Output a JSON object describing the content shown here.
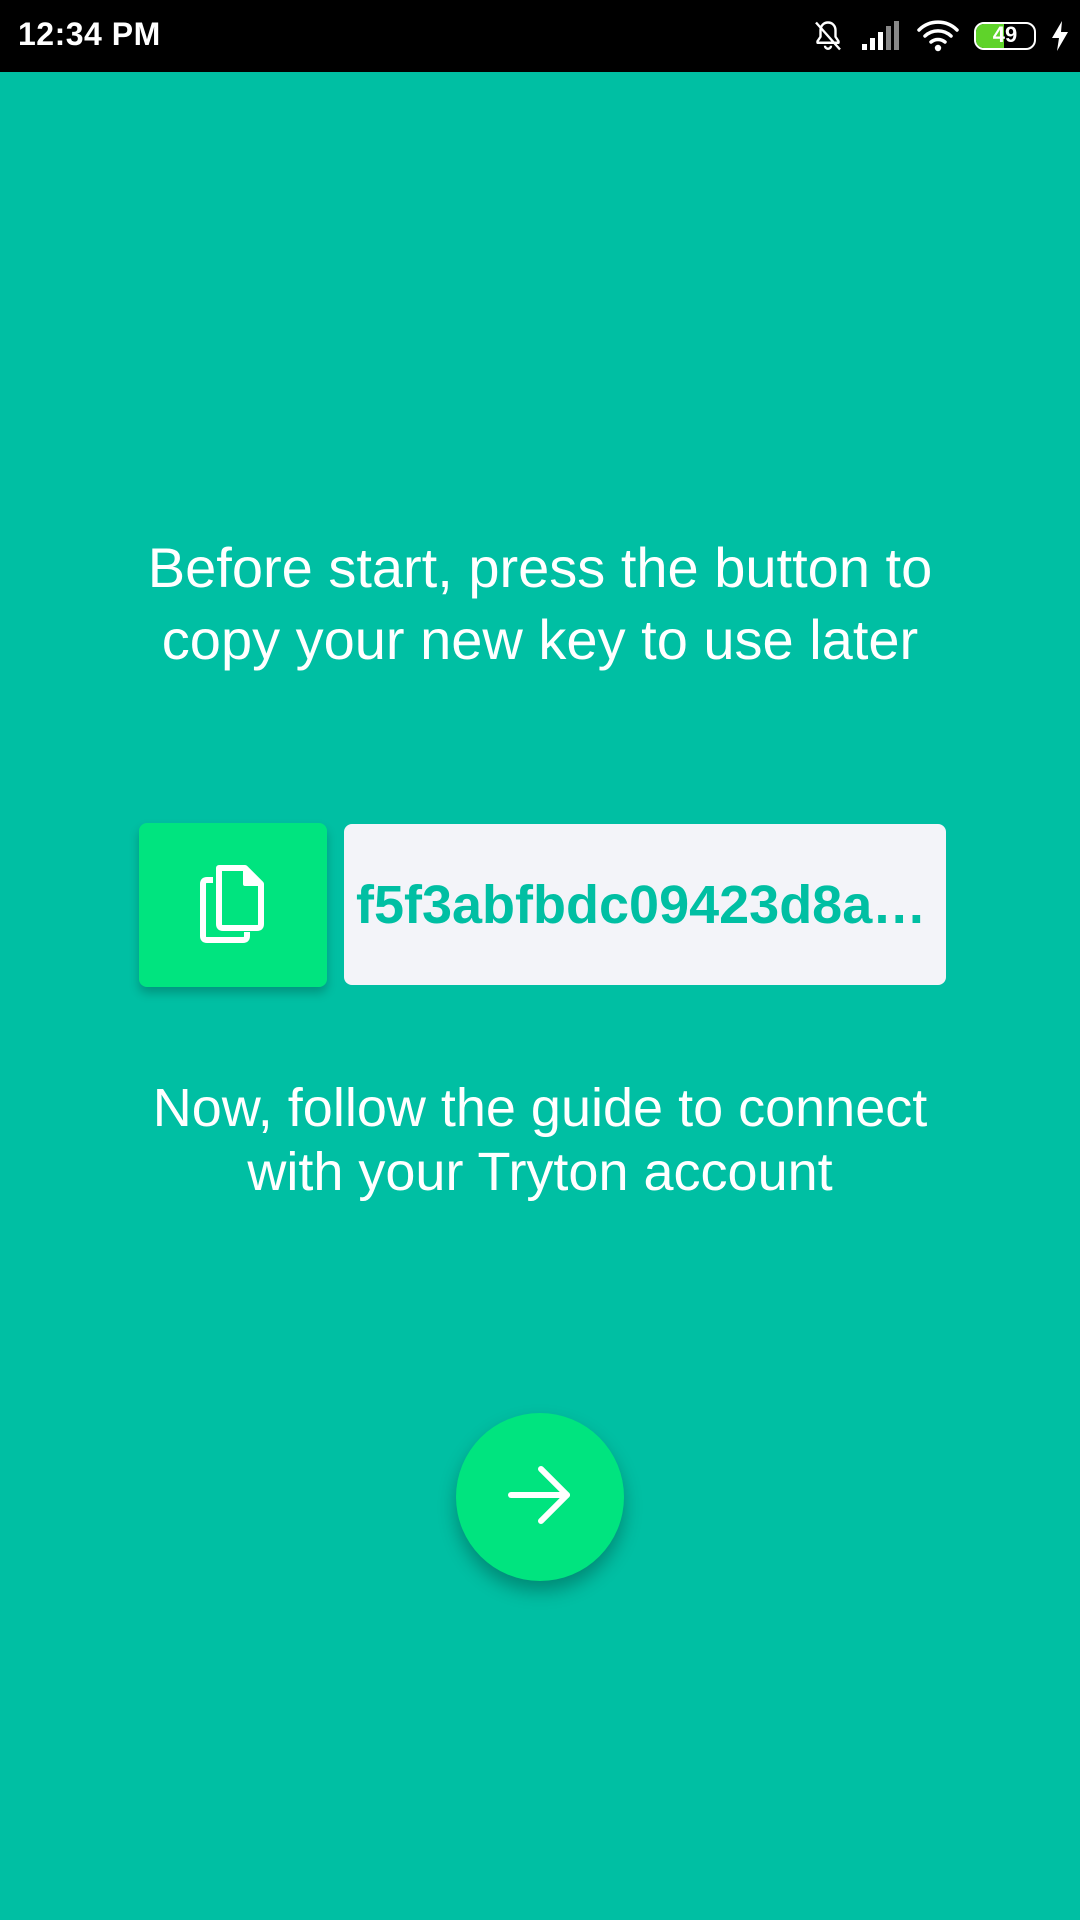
{
  "status_bar": {
    "time": "12:34 PM",
    "battery_level": "49",
    "battery_percent": 49,
    "icons": [
      "bell-muted-icon",
      "cell-signal-icon",
      "wifi-icon",
      "battery-icon",
      "charging-bolt-icon"
    ]
  },
  "main": {
    "instruction": "Before start, press the button to copy your new key to use later",
    "key_value": "f5f3abfbdc09423d8a…",
    "guide_text": "Now, follow the guide to connect with your Tryton account"
  },
  "icons": {
    "copy": "copy-icon",
    "next": "arrow-right-icon"
  },
  "colors": {
    "background": "#00bfa3",
    "accent": "#00e47f",
    "field_background": "#f3f4f9",
    "status_bar": "#000000"
  }
}
